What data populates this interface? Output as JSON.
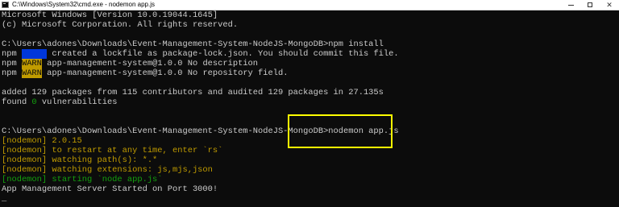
{
  "window": {
    "title": "C:\\Windows\\System32\\cmd.exe - nodemon app.js",
    "minimize_glyph": "",
    "maximize_glyph": "",
    "close_glyph": "✕"
  },
  "console": {
    "lines": [
      [
        {
          "text": "Microsoft Windows [Version 10.0.19044.1645]"
        }
      ],
      [
        {
          "text": "(c) Microsoft Corporation. All rights reserved."
        }
      ],
      [
        {
          "text": ""
        }
      ],
      [
        {
          "text": "C:\\Users\\adones\\Downloads\\Event-Management-System-NodeJS-MongoDB>npm install"
        }
      ],
      [
        {
          "text": "npm "
        },
        {
          "text": "     ",
          "style": "hl-blue"
        },
        {
          "text": " created a lockfile as package-lock.json. You should commit this file."
        }
      ],
      [
        {
          "text": "npm "
        },
        {
          "text": "WARN",
          "style": "hl-warn"
        },
        {
          "text": " app-management-system@1.0.0 No description"
        }
      ],
      [
        {
          "text": "npm "
        },
        {
          "text": "WARN",
          "style": "hl-warn"
        },
        {
          "text": " app-management-system@1.0.0 No repository field."
        }
      ],
      [
        {
          "text": ""
        }
      ],
      [
        {
          "text": "added 129 packages from 115 contributors and audited 129 packages in 27.135s"
        }
      ],
      [
        {
          "text": "found "
        },
        {
          "text": "0",
          "style": "seg-green"
        },
        {
          "text": " vulnerabilities"
        }
      ],
      [
        {
          "text": ""
        }
      ],
      [
        {
          "text": ""
        }
      ],
      [
        {
          "text": "C:\\Users\\adones\\Downloads\\Event-Management-System-NodeJS-MongoDB>nodemon app.js"
        }
      ],
      [
        {
          "text": "[nodemon] 2.0.15",
          "style": "seg-yellow"
        }
      ],
      [
        {
          "text": "[nodemon] to restart at any time, enter `rs`",
          "style": "seg-yellow"
        }
      ],
      [
        {
          "text": "[nodemon] watching path(s): *.*",
          "style": "seg-yellow"
        }
      ],
      [
        {
          "text": "[nodemon] watching extensions: js,mjs,json",
          "style": "seg-yellow"
        }
      ],
      [
        {
          "text": "[nodemon] starting `node app.js`",
          "style": "seg-green"
        }
      ],
      [
        {
          "text": "App Management Server Started on Port 3000!"
        }
      ],
      [
        {
          "text": "_"
        }
      ]
    ]
  },
  "annotation": {
    "box_color": "#ffff00"
  },
  "colors": {
    "background": "#0c0c0c",
    "foreground": "#cccccc",
    "warn_bg": "#c19c00",
    "nodemon_yellow": "#c19c00",
    "nodemon_green": "#13a10e"
  }
}
